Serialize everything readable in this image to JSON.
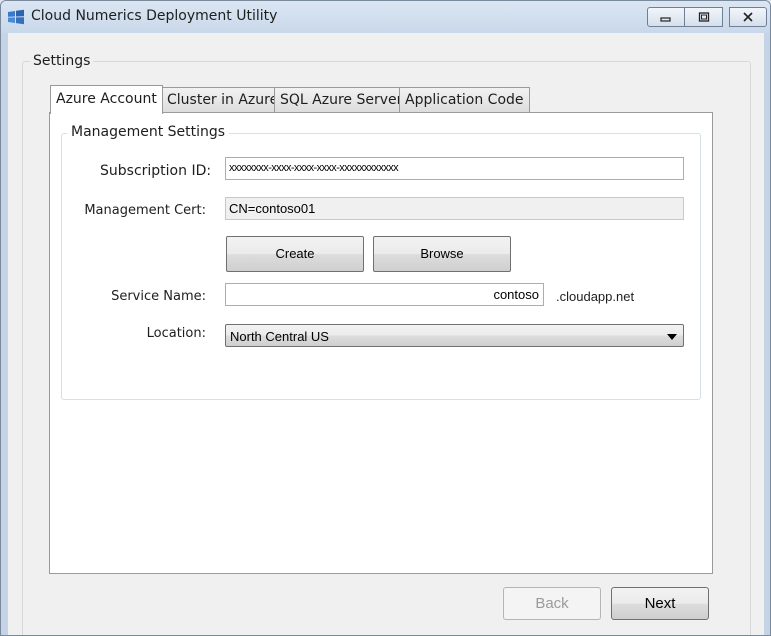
{
  "window": {
    "title": "Cloud Numerics Deployment Utility",
    "controls": {
      "minimize_icon": "minimize-icon",
      "maximize_icon": "maximize-icon",
      "close_icon": "close-icon"
    }
  },
  "settings": {
    "legend": "Settings",
    "tabs": [
      {
        "label": "Azure Account",
        "active": true
      },
      {
        "label": "Cluster in Azure",
        "active": false
      },
      {
        "label": "SQL Azure Server",
        "active": false
      },
      {
        "label": "Application Code",
        "active": false
      }
    ],
    "management": {
      "legend": "Management Settings",
      "subscription_label": "Subscription ID:",
      "subscription_value": "xxxxxxxx-xxxx-xxxx-xxxx-xxxxxxxxxxxx",
      "cert_label": "Management Cert:",
      "cert_value": "CN=contoso01",
      "create_label": "Create",
      "browse_label": "Browse",
      "service_label": "Service Name:",
      "service_value": "contoso",
      "service_suffix": ".cloudapp.net",
      "location_label": "Location:",
      "location_value": "North Central US"
    }
  },
  "footer": {
    "back_label": "Back",
    "back_enabled": false,
    "next_label": "Next"
  }
}
